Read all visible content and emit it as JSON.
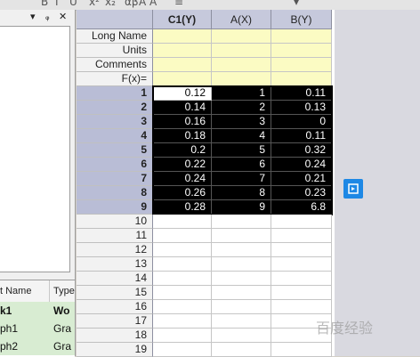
{
  "toolbar": {
    "glyphs": [
      "B",
      "I",
      "U",
      "x²",
      "x₂",
      "αβ",
      "A",
      "A",
      "≡",
      "▾"
    ]
  },
  "left_panel": {
    "pane_controls": {
      "dropdown": "▾",
      "pin": "ᵩ",
      "close": "✕"
    },
    "list": {
      "columns": [
        "t Name",
        "Type"
      ],
      "rows": [
        {
          "name": "k1",
          "type": "Wo",
          "bold": true
        },
        {
          "name": "ph1",
          "type": "Gra",
          "bold": false
        },
        {
          "name": "ph2",
          "type": "Gra",
          "bold": false
        }
      ]
    }
  },
  "grid": {
    "columns": [
      "C1(Y)",
      "A(X)",
      "B(Y)"
    ],
    "meta_rows": [
      "Long Name",
      "Units",
      "Comments",
      "F(x)="
    ],
    "data_rows": [
      [
        "0.12",
        "1",
        "0.11"
      ],
      [
        "0.14",
        "2",
        "0.13"
      ],
      [
        "0.16",
        "3",
        "0"
      ],
      [
        "0.18",
        "4",
        "0.11"
      ],
      [
        "0.2",
        "5",
        "0.32"
      ],
      [
        "0.22",
        "6",
        "0.24"
      ],
      [
        "0.24",
        "7",
        "0.21"
      ],
      [
        "0.26",
        "8",
        "0.23"
      ],
      [
        "0.28",
        "9",
        "6.8"
      ]
    ],
    "empty_row_numbers": [
      "10",
      "11",
      "12",
      "13",
      "14",
      "15",
      "16",
      "17",
      "18",
      "19"
    ]
  },
  "watermark": "百度经验",
  "colors": {
    "header_bg": "#c6c9dc",
    "meta_bg": "#fbfbc3",
    "selection_bg": "#000000",
    "selected_row_header": "#b9bdd6",
    "float_button": "#1e88e5",
    "list_highlight": "#d8ecd2"
  },
  "icons": {
    "float_button": "open-window-icon"
  }
}
